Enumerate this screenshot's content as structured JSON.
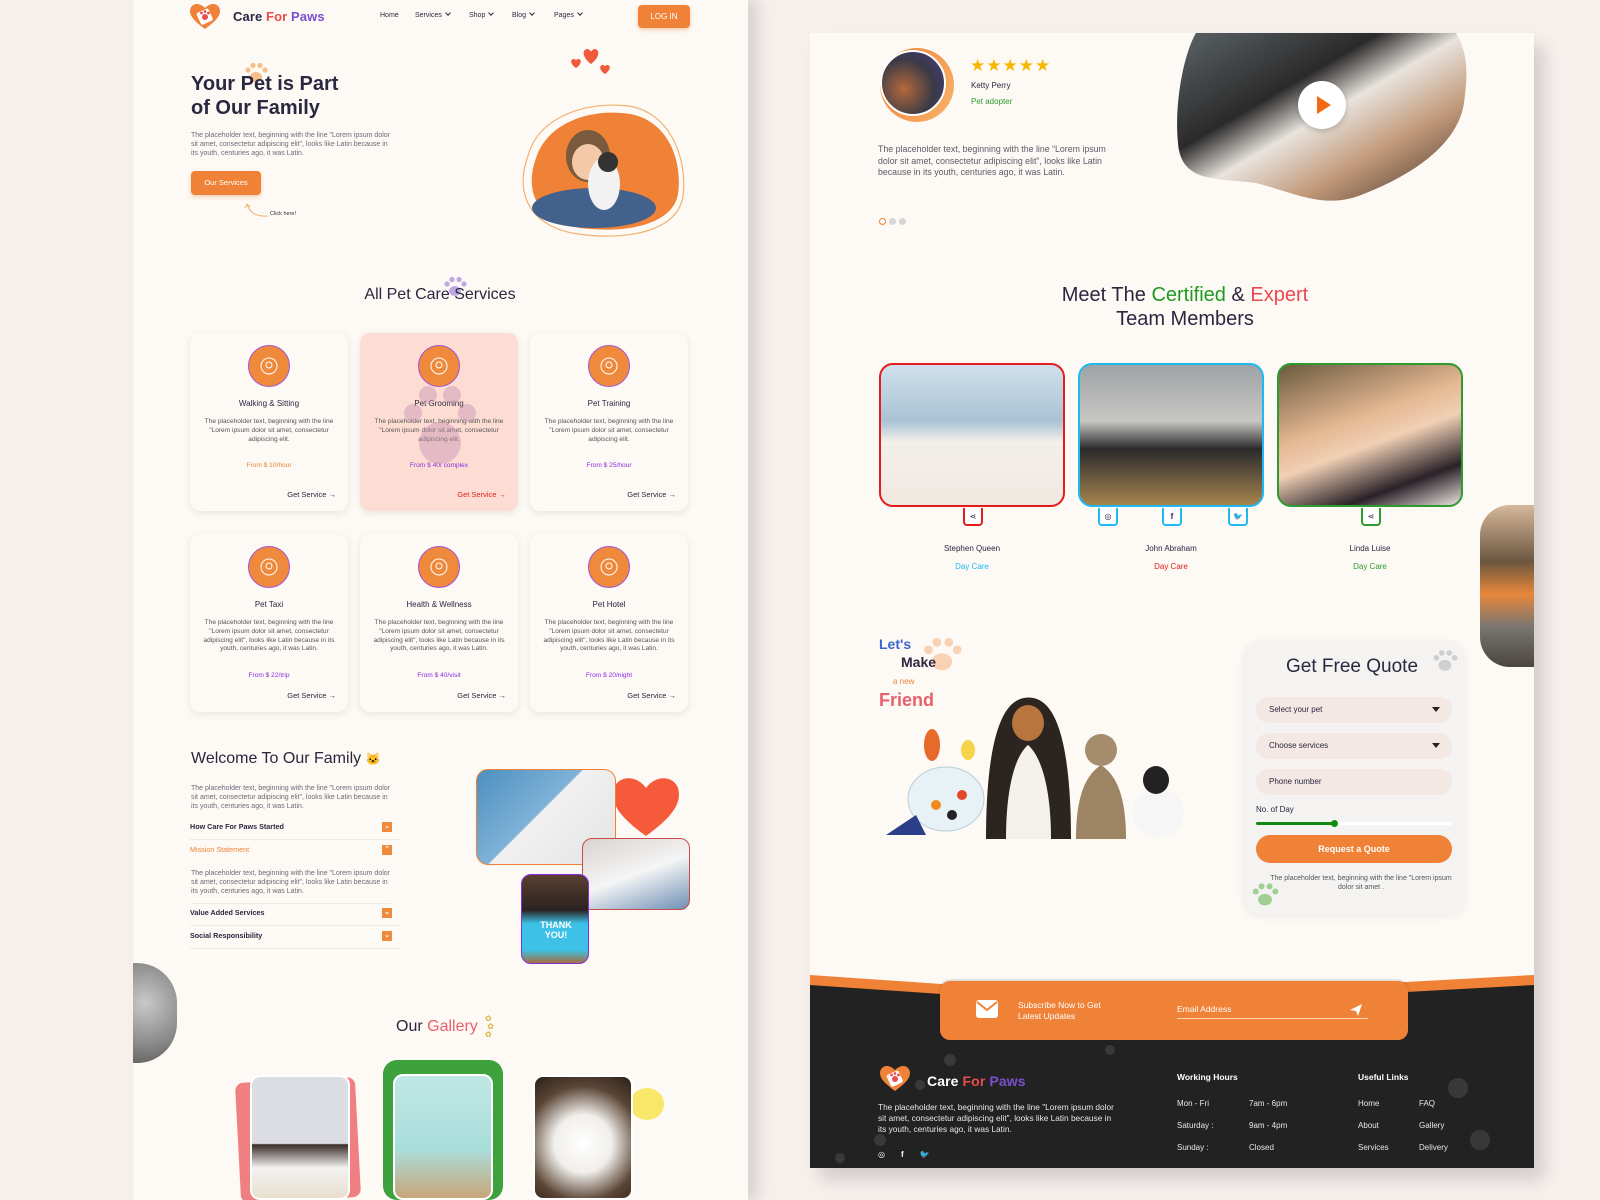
{
  "brand": {
    "part1": "Care",
    "part2": "For",
    "part3": "Paws",
    "colors": {
      "care": "#2a2740",
      "for": "#e94c4c",
      "paws": "#7a4fcf"
    }
  },
  "nav": {
    "items": [
      {
        "label": "Home",
        "has_dropdown": false
      },
      {
        "label": "Services",
        "has_dropdown": true
      },
      {
        "label": "Shop",
        "has_dropdown": true
      },
      {
        "label": "Blog",
        "has_dropdown": true
      },
      {
        "label": "Pages",
        "has_dropdown": true
      }
    ],
    "login_label": "LOG IN"
  },
  "hero": {
    "title_line1": "Your Pet is Part",
    "title_line2": "of Our Family",
    "body": "The placeholder text, beginning with the line \"Lorem ipsum dolor sit amet, consectetur adipiscing elit\", looks like Latin because in its youth, centuries ago, it was Latin.",
    "cta_label": "Our Services",
    "hint": "Click here!"
  },
  "services": {
    "title": "All Pet Care Services",
    "get_service_label": "Get Service →",
    "items": [
      {
        "name": "Walking & Sitting",
        "icon": "dog-walking-icon",
        "desc": "The placeholder text, beginning with the line \"Lorem ipsum dolor sit amet, consectetur adipiscing elit.",
        "price": "From $ 10/hour",
        "price_color": "#ef8236",
        "highlighted": false
      },
      {
        "name": "Pet Grooming",
        "icon": "grooming-icon",
        "desc": "The placeholder text, beginning with the line \"Lorem ipsum dolor sit amet, consectetur adipiscing elit.",
        "price": "From $ 40/ complex",
        "price_color": "#8a2be2",
        "highlighted": true
      },
      {
        "name": "Pet Training",
        "icon": "dog-training-icon",
        "desc": "The placeholder text, beginning with the line \"Lorem ipsum dolor sit amet, consectetur adipiscing elit.",
        "price": "From $ 25/hour",
        "price_color": "#8a2be2",
        "highlighted": false
      },
      {
        "name": "Pet Taxi",
        "icon": "pet-taxi-icon",
        "desc": "The placeholder text, beginning with the line \"Lorem ipsum dolor sit amet, consectetur adipiscing elit\", looks like Latin because in its youth, centuries ago, it was Latin.",
        "price": "From $ 22/trip",
        "price_color": "#8a2be2",
        "highlighted": false
      },
      {
        "name": "Health & Wellness",
        "icon": "heart-pet-icon",
        "desc": "The placeholder text, beginning with the line \"Lorem ipsum dolor sit amet, consectetur adipiscing elit\", looks like Latin because in its youth, centuries ago, it was Latin.",
        "price": "From $ 40/visit",
        "price_color": "#8a2be2",
        "highlighted": false
      },
      {
        "name": "Pet Hotel",
        "icon": "pet-hotel-icon",
        "desc": "The placeholder text, beginning with the line \"Lorem ipsum dolor sit amet, consectetur adipiscing elit\", looks like Latin because in its youth, centuries ago, it was Latin.",
        "price": "From $ 20/night",
        "price_color": "#8a2be2",
        "highlighted": false
      }
    ]
  },
  "welcome": {
    "title": "Welcome To Our Family",
    "body": "The placeholder text, beginning with the line \"Lorem ipsum dolor sit amet, consectetur adipiscing elit\", looks like Latin because in its youth, centuries ago, it was Latin.",
    "accordion": [
      {
        "label": "How Care For Paws Started",
        "expanded": false
      },
      {
        "label": "Mission Statement",
        "expanded": true,
        "content": "The placeholder text, beginning with the line \"Lorem ipsum dolor sit amet, consectetur adipiscing elit\", looks like Latin because in its youth, centuries ago, it was Latin."
      },
      {
        "label": "Value Added Services",
        "expanded": false
      },
      {
        "label": "Social Responsibility",
        "expanded": false
      }
    ],
    "thankyou_card": "THANK YOU!"
  },
  "gallery": {
    "title_part1": "Our",
    "title_part2": "Gallery"
  },
  "testimonial": {
    "rating": 5,
    "max_rating": 5,
    "name": "Ketty Perry",
    "role": "Pet adopter",
    "quote": "The placeholder text, beginning with the line “Lorem ipsum dolor sit amet, consectetur adipiscing elit”, looks like Latin because in its youth, centuries ago, it was Latin.",
    "slides": 3,
    "active_slide": 1
  },
  "team": {
    "title_part1": "Meet The",
    "title_part2": "Certified",
    "title_part3": "&",
    "title_part4": "Expert",
    "title_line2": "Team Members",
    "members": [
      {
        "name": "Stephen Queen",
        "role": "Day Care",
        "border_color": "#e51c1c",
        "role_color": "#1fb8f0",
        "socials": [
          "share-icon"
        ]
      },
      {
        "name": "John Abraham",
        "role": "Day Care",
        "border_color": "#1fb8f0",
        "role_color": "#e51c1c",
        "socials": [
          "instagram-icon",
          "facebook-icon",
          "twitter-icon"
        ]
      },
      {
        "name": "Linda Luise",
        "role": "Day Care",
        "border_color": "#2f9a2f",
        "role_color": "#2f9a2f",
        "socials": [
          "share-icon"
        ]
      }
    ]
  },
  "friend": {
    "line1": "Let's",
    "line2": "Make",
    "line3": "a new",
    "line4": "Friend"
  },
  "quote_form": {
    "title": "Get Free Quote",
    "select_pet": "Select your pet",
    "choose_services": "Choose services",
    "phone_placeholder": "Phone number",
    "days_label": "No. of Day",
    "days_fraction": 0.4,
    "submit_label": "Request a Quote",
    "note": "The placeholder text, beginning with the line \"Lorem ipsum dolor sit amet ."
  },
  "subscribe": {
    "text_line1": "Subscribe Now to Get",
    "text_line2": "Latest Updates",
    "email_placeholder": "Email Address"
  },
  "footer": {
    "about": "The placeholder text, beginning with the line \"Lorem ipsum dolor sit amet, consectetur adipiscing elit\", looks like Latin because in its youth, centuries ago, it was Latin.",
    "socials": [
      "instagram-icon",
      "facebook-icon",
      "twitter-icon"
    ],
    "hours_title": "Working Hours",
    "hours": [
      {
        "day": "Mon - Fri",
        "time": "7am - 6pm"
      },
      {
        "day": "Saturday :",
        "time": "9am - 4pm"
      },
      {
        "day": "Sunday :",
        "time": "Closed"
      }
    ],
    "links_title": "Useful Links",
    "links_col1": [
      "Home",
      "About",
      "Services"
    ],
    "links_col2": [
      "FAQ",
      "Gallery",
      "Delivery"
    ]
  },
  "colors": {
    "accent": "#ef8236",
    "dark": "#2a2740",
    "footer_bg": "#232222",
    "page_bg": "#fdf9f5"
  }
}
